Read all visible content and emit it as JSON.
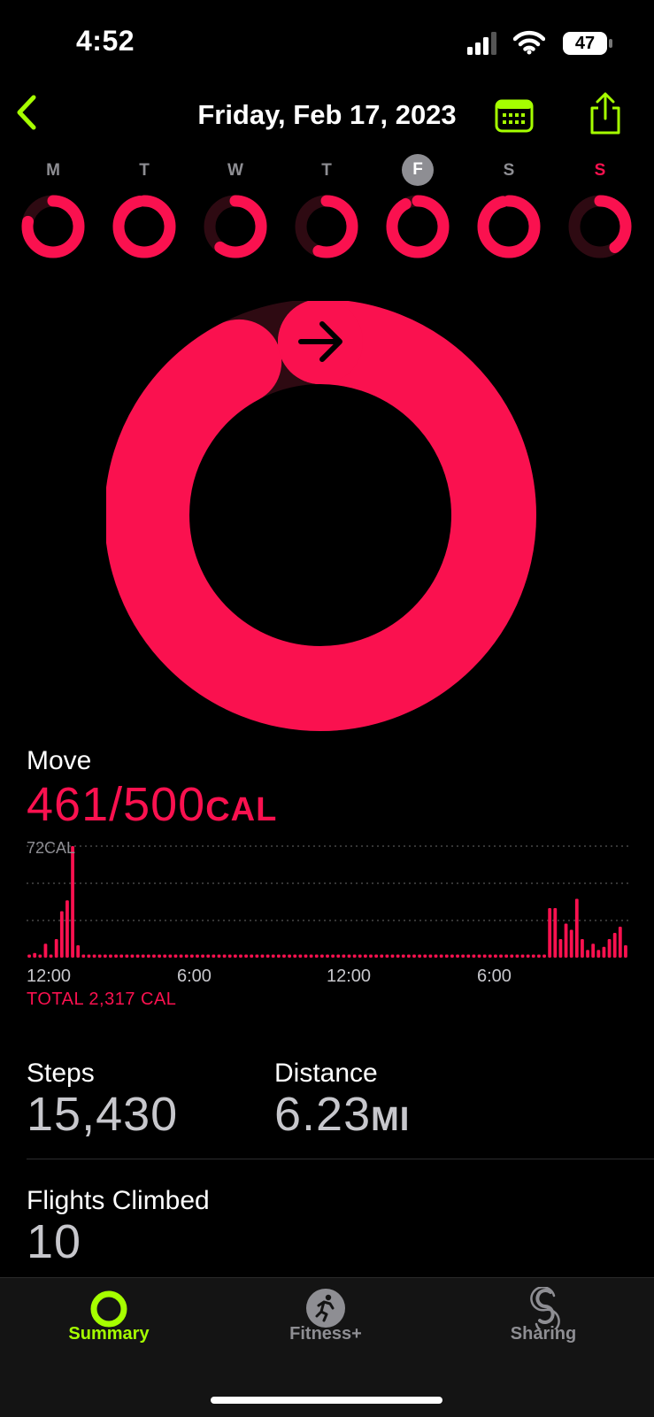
{
  "status_bar": {
    "time": "4:52",
    "battery": "47"
  },
  "header": {
    "date": "Friday, Feb 17, 2023"
  },
  "week": {
    "days": [
      {
        "label": "M",
        "progress": 0.78,
        "today": false,
        "red": false
      },
      {
        "label": "T",
        "progress": 0.97,
        "today": false,
        "red": false
      },
      {
        "label": "W",
        "progress": 0.6,
        "today": false,
        "red": false
      },
      {
        "label": "T",
        "progress": 0.55,
        "today": false,
        "red": false
      },
      {
        "label": "F",
        "progress": 0.92,
        "today": true,
        "red": false
      },
      {
        "label": "S",
        "progress": 0.96,
        "today": false,
        "red": false
      },
      {
        "label": "S",
        "progress": 0.4,
        "today": false,
        "red": true
      }
    ]
  },
  "ring": {
    "progress": 0.922,
    "color": "#fa114f",
    "track_color": "#2e0a12"
  },
  "move": {
    "label": "Move",
    "value": "461/500",
    "unit": "CAL",
    "chart_max": "72CAL",
    "total": "TOTAL 2,317 CAL"
  },
  "chart_data": {
    "type": "bar",
    "title": "",
    "ylabel": "",
    "ymax": 72,
    "ylim": [
      0,
      72
    ],
    "x_ticks": [
      "12:00",
      "6:00",
      "12:00",
      "6:00"
    ],
    "values": [
      2,
      3,
      2,
      9,
      2,
      12,
      30,
      37,
      72,
      8,
      2,
      2,
      2,
      2,
      2,
      2,
      2,
      2,
      2,
      2,
      2,
      2,
      2,
      2,
      2,
      2,
      2,
      2,
      2,
      2,
      2,
      2,
      2,
      2,
      2,
      2,
      2,
      2,
      2,
      2,
      2,
      2,
      2,
      2,
      2,
      2,
      2,
      2,
      2,
      2,
      2,
      2,
      2,
      2,
      2,
      2,
      2,
      2,
      2,
      2,
      2,
      2,
      2,
      2,
      2,
      2,
      2,
      2,
      2,
      2,
      2,
      2,
      2,
      2,
      2,
      2,
      2,
      2,
      2,
      2,
      2,
      2,
      2,
      2,
      2,
      2,
      2,
      2,
      2,
      2,
      2,
      2,
      2,
      2,
      2,
      2,
      32,
      32,
      12,
      22,
      18,
      38,
      12,
      5,
      9,
      5,
      7,
      12,
      16,
      20,
      8
    ],
    "color": "#fa114f"
  },
  "stats": {
    "steps_label": "Steps",
    "steps_value": "15,430",
    "distance_label": "Distance",
    "distance_value": "6.23",
    "distance_unit": "MI",
    "flights_label": "Flights Climbed",
    "flights_value": "10"
  },
  "tabs": [
    {
      "label": "Summary",
      "icon": "activity-ring-icon",
      "active": true
    },
    {
      "label": "Fitness+",
      "icon": "running-figure-icon",
      "active": false
    },
    {
      "label": "Sharing",
      "icon": "sharing-rings-icon",
      "active": false
    }
  ],
  "colors": {
    "accent": "#a6ff00",
    "move": "#fa114f"
  }
}
